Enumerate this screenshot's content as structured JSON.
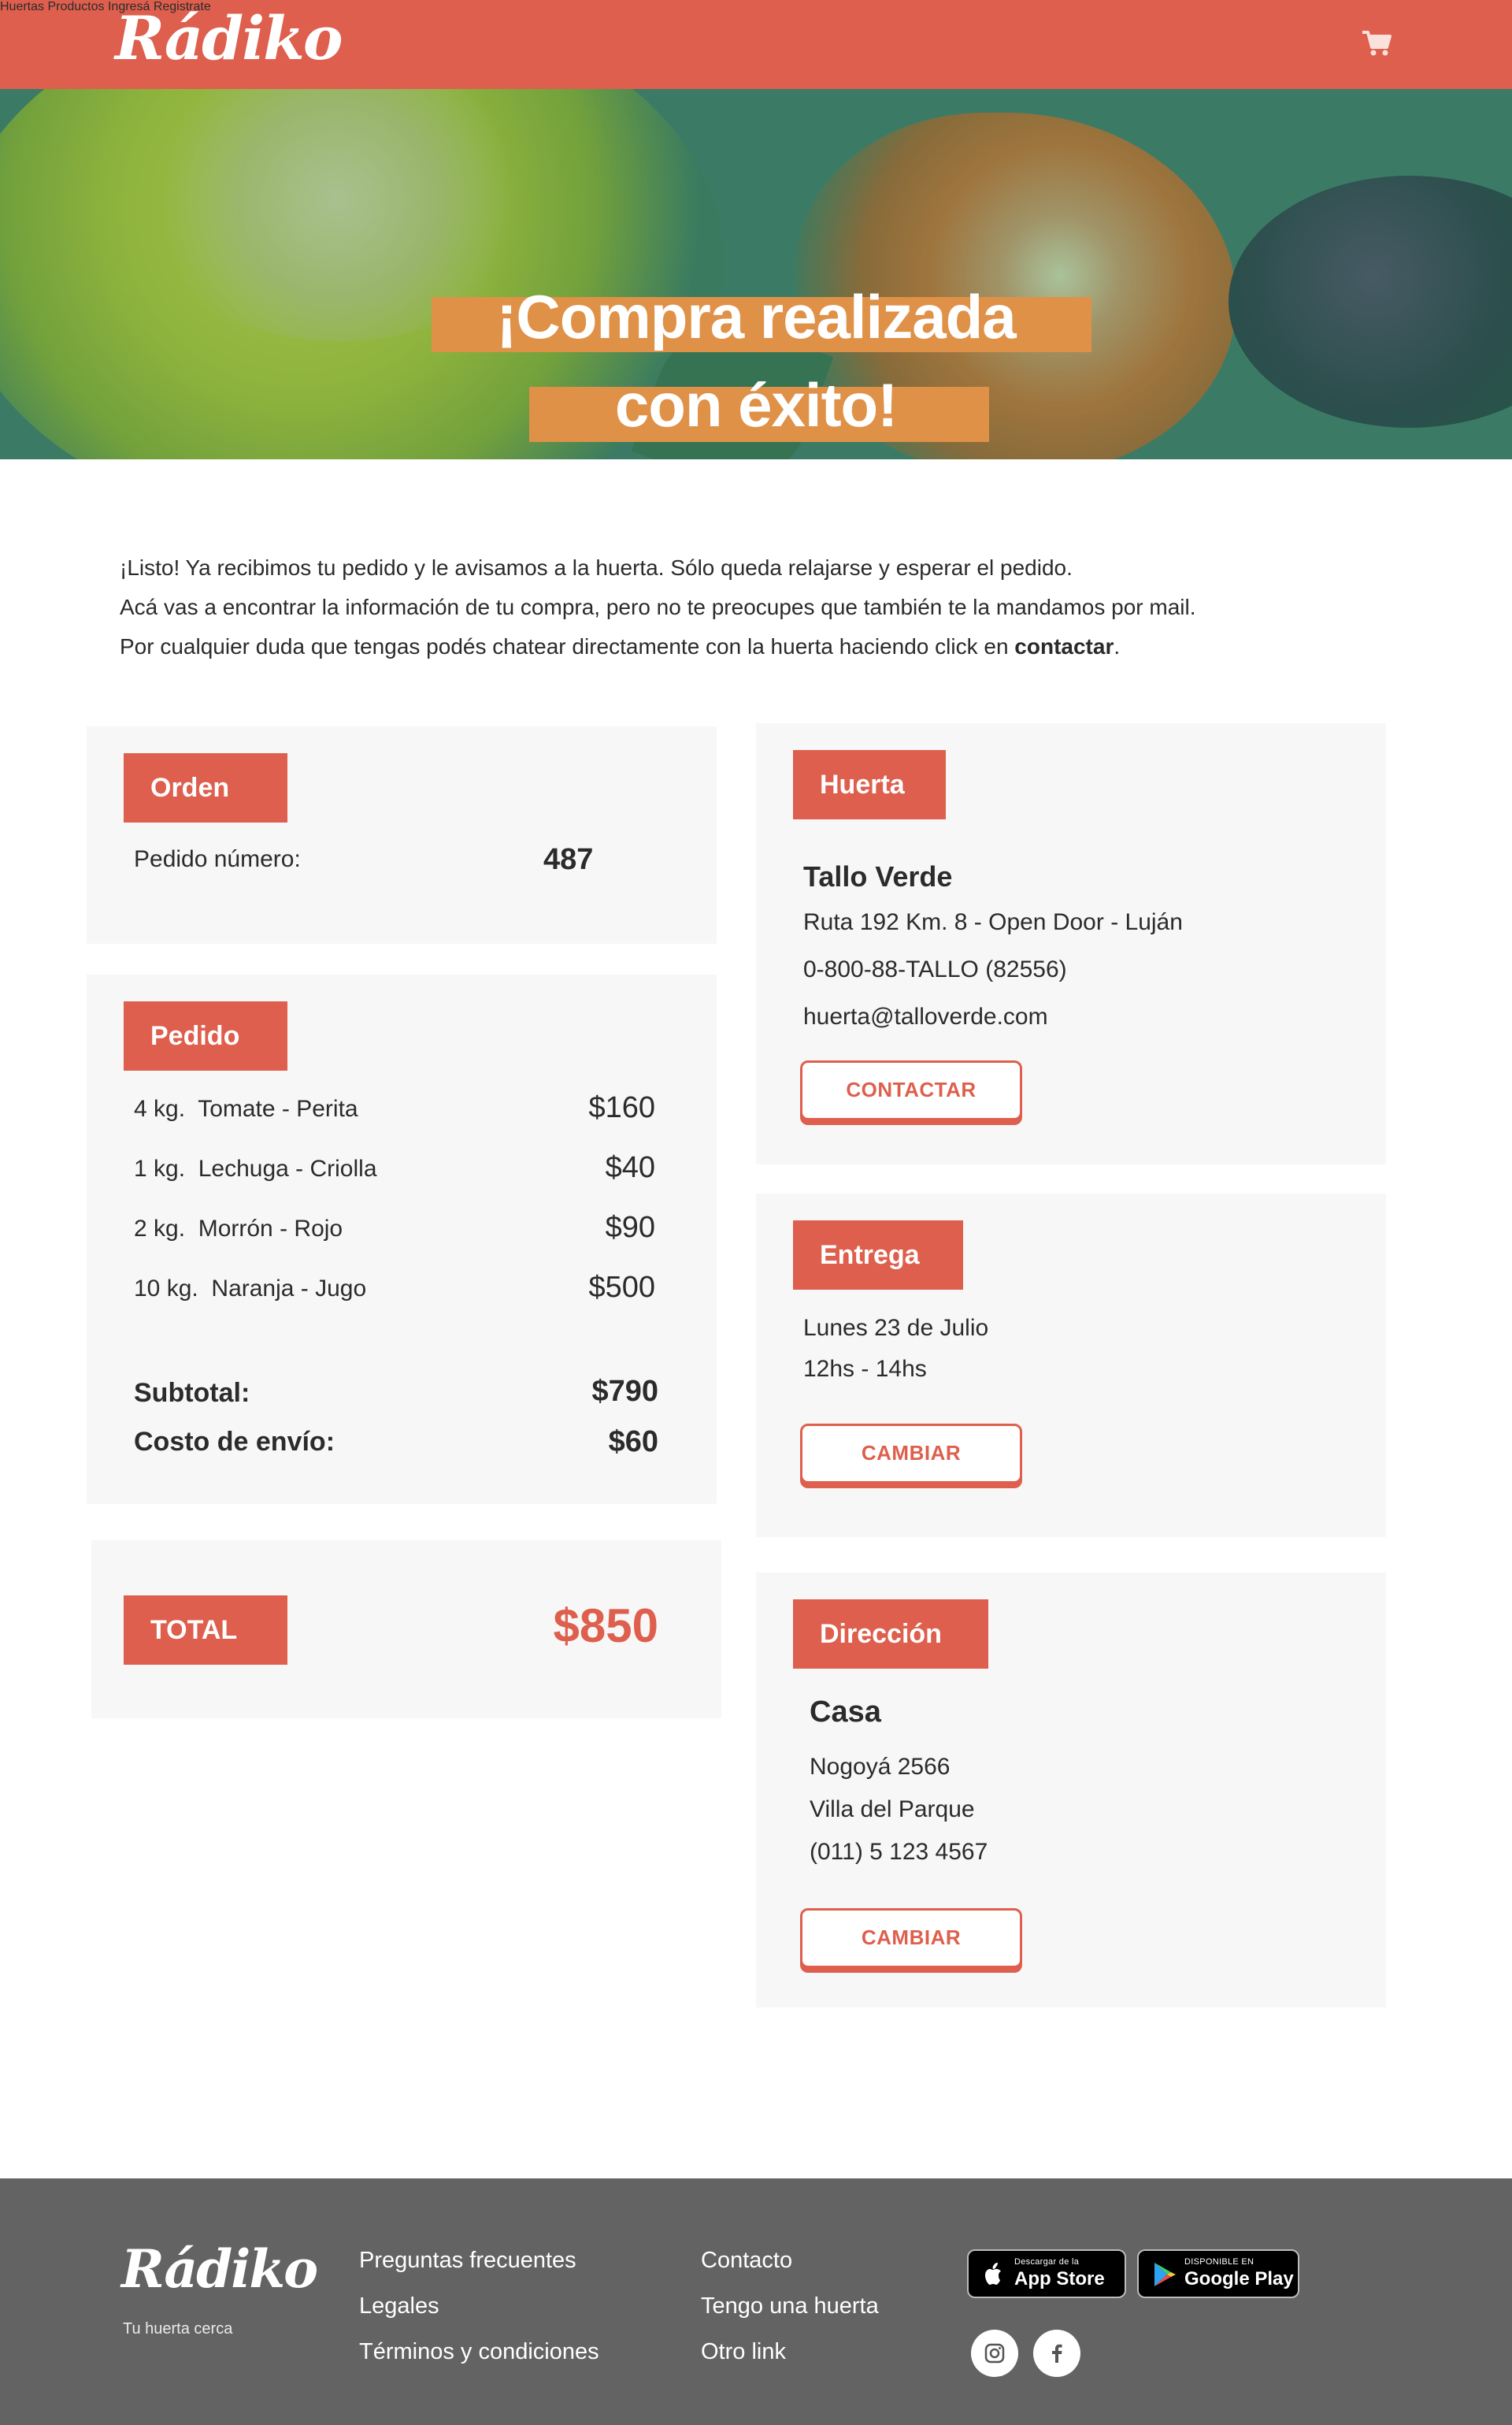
{
  "header": {
    "logo": "Rádiko",
    "nav": [
      "Huertas",
      "Productos",
      "Ingresá",
      "Registrate"
    ],
    "cart_icon": "cart-icon"
  },
  "hero": {
    "title_line1": "¡Compra realizada",
    "title_line2": "con éxito!"
  },
  "intro": {
    "line1": "¡Listo! Ya recibimos tu pedido y le avisamos a la huerta. Sólo queda relajarse y esperar el pedido.",
    "line2": "Acá vas a encontrar la información de tu compra, pero no te preocupes que también te la mandamos por mail.",
    "line3_prefix": "Por cualquier duda que tengas podés chatear directamente con la huerta haciendo click en ",
    "line3_bold": "contactar",
    "line3_suffix": "."
  },
  "orden": {
    "tag": "Orden",
    "label": "Pedido número:",
    "number": "487"
  },
  "pedido": {
    "tag": "Pedido",
    "items": [
      {
        "qty": "4 kg.",
        "name": "Tomate - Perita",
        "price": "$160"
      },
      {
        "qty": "1 kg.",
        "name": "Lechuga - Criolla",
        "price": "$40"
      },
      {
        "qty": "2 kg.",
        "name": "Morrón - Rojo",
        "price": "$90"
      },
      {
        "qty": "10 kg.",
        "name": "Naranja - Jugo",
        "price": "$500"
      }
    ],
    "subtotal_label": "Subtotal:",
    "subtotal_value": "$790",
    "shipping_label": "Costo de envío:",
    "shipping_value": "$60"
  },
  "total": {
    "tag": "TOTAL",
    "value": "$850"
  },
  "huerta": {
    "tag": "Huerta",
    "name": "Tallo Verde",
    "address": "Ruta 192 Km. 8 - Open Door - Luján",
    "phone": "0-800-88-TALLO (82556)",
    "email": "huerta@talloverde.com",
    "button": "CONTACTAR"
  },
  "entrega": {
    "tag": "Entrega",
    "date": "Lunes 23 de Julio",
    "time": "12hs - 14hs",
    "button": "CAMBIAR"
  },
  "direccion": {
    "tag": "Dirección",
    "name": "Casa",
    "street": "Nogoyá 2566",
    "area": "Villa del Parque",
    "phone": "(011) 5 123 4567",
    "button": "CAMBIAR"
  },
  "footer": {
    "logo": "Rádiko",
    "tagline": "Tu huerta cerca",
    "col1": [
      "Preguntas frecuentes",
      "Legales",
      "Términos y condiciones"
    ],
    "col2": [
      "Contacto",
      "Tengo una huerta",
      "Otro link"
    ],
    "appstore_small": "Descargar de la",
    "appstore_big": "App Store",
    "googleplay_small": "DISPONIBLE EN",
    "googleplay_big": "Google Play",
    "social": [
      "instagram-icon",
      "facebook-icon"
    ]
  },
  "colors": {
    "brand": "#de5f4d",
    "accent": "#df9148",
    "card_bg": "#f7f7f7",
    "footer_bg": "#636363"
  }
}
